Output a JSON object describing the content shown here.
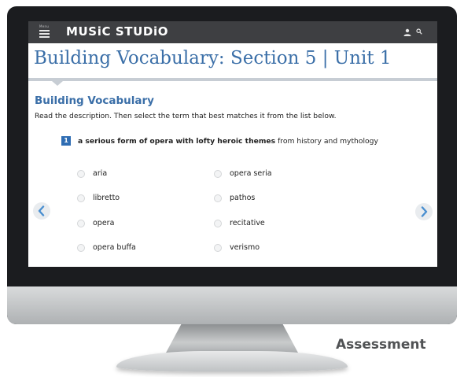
{
  "app": {
    "menu_label": "Menu",
    "brand": "MUSiC STUDiO"
  },
  "page": {
    "title": "Building Vocabulary: Section 5 | Unit 1",
    "section_heading": "Building Vocabulary",
    "instructions": "Read the description. Then select the term that best matches it from the list below."
  },
  "question": {
    "number": "1",
    "text_prefix": "a serious form of opera with lofty heroic themes",
    "text_suffix": " from history and mythology"
  },
  "options": {
    "left": [
      "aria",
      "libretto",
      "opera",
      "opera buffa"
    ],
    "right": [
      "opera seria",
      "pathos",
      "recitative",
      "verismo"
    ]
  },
  "caption": "Assessment",
  "colors": {
    "accent": "#3b6fa8",
    "header_bg": "#3e3f42",
    "question_badge": "#2f6db3"
  },
  "icons": {
    "menu": "hamburger-menu-icon",
    "user": "user-icon",
    "search": "search-icon",
    "prev": "chevron-left-icon",
    "next": "chevron-right-icon"
  }
}
